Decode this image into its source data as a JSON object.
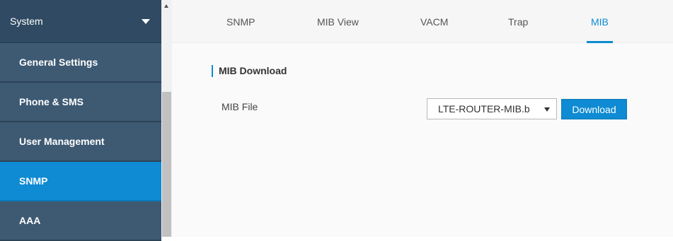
{
  "sidebar": {
    "header": "System",
    "items": [
      {
        "label": "General Settings",
        "active": false
      },
      {
        "label": "Phone & SMS",
        "active": false
      },
      {
        "label": "User Management",
        "active": false
      },
      {
        "label": "SNMP",
        "active": true
      },
      {
        "label": "AAA",
        "active": false
      }
    ]
  },
  "tabs": [
    {
      "label": "SNMP",
      "active": false
    },
    {
      "label": "MIB View",
      "active": false
    },
    {
      "label": "VACM",
      "active": false
    },
    {
      "label": "Trap",
      "active": false
    },
    {
      "label": "MIB",
      "active": true
    }
  ],
  "main": {
    "section_title": "MIB Download",
    "mib_file_label": "MIB File",
    "mib_file_value": "LTE-ROUTER-MIB.b",
    "download_button": "Download"
  },
  "colors": {
    "accent": "#0e8bd2",
    "sidebar_bg": "#3e5a73",
    "sidebar_header_bg": "#2f4a62"
  },
  "icons": {
    "sidebar_header": "caret-down-icon",
    "select": "dropdown-arrow-icon",
    "scrollbar": "scroll-up-arrow-icon"
  }
}
